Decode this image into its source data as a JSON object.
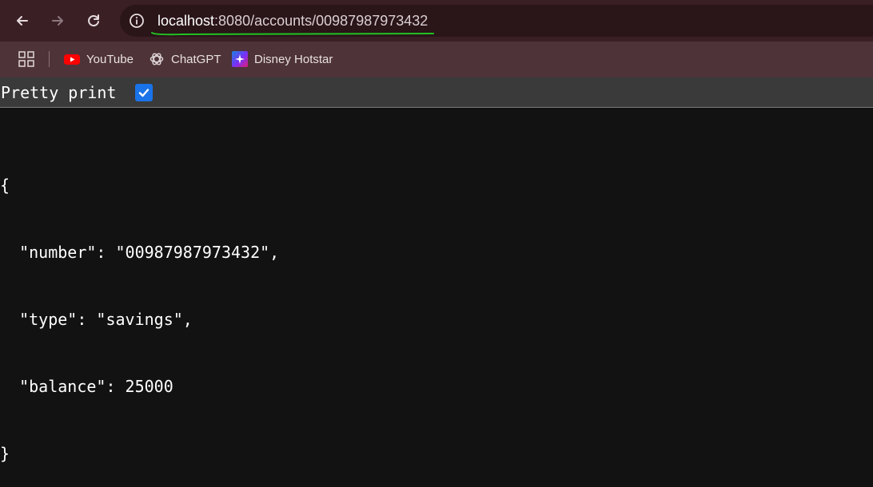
{
  "browser": {
    "url_host": "localhost",
    "url_rest": ":8080/accounts/00987987973432",
    "icons": {
      "back": "arrow-left-icon",
      "forward": "arrow-right-icon",
      "reload": "reload-icon",
      "site_info": "info-icon"
    }
  },
  "bookmarks": [
    {
      "label": "YouTube",
      "icon": "youtube-icon"
    },
    {
      "label": "ChatGPT",
      "icon": "chatgpt-icon"
    },
    {
      "label": "Disney Hotstar",
      "icon": "hotstar-icon"
    }
  ],
  "viewer": {
    "pretty_print_label": "Pretty print",
    "pretty_print_checked": true
  },
  "json_lines": [
    "{",
    "  \"number\": \"00987987973432\",",
    "  \"type\": \"savings\",",
    "  \"balance\": 25000",
    "}"
  ],
  "colors": {
    "toolbar": "#3a1f25",
    "bookmarks_bar": "#4e3338",
    "page_bg": "#121212",
    "checkbox": "#1a73e8",
    "url_annotation": "#22c322"
  }
}
